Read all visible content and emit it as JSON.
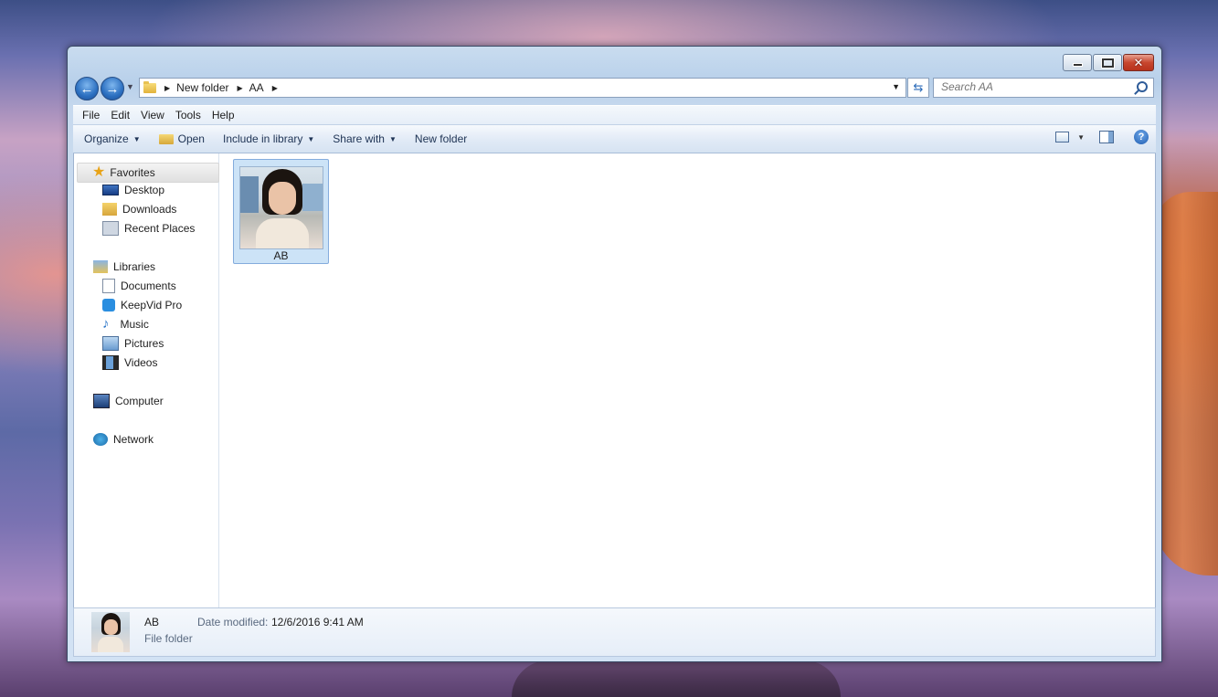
{
  "window": {
    "address": {
      "crumbs": [
        "New folder",
        "AA"
      ]
    },
    "search": {
      "placeholder": "Search AA"
    },
    "menu": [
      "File",
      "Edit",
      "View",
      "Tools",
      "Help"
    ],
    "toolbar": {
      "organize": "Organize",
      "open": "Open",
      "include": "Include in library",
      "share": "Share with",
      "new_folder": "New folder"
    },
    "nav": {
      "favorites": "Favorites",
      "desktop": "Desktop",
      "downloads": "Downloads",
      "recent": "Recent Places",
      "libraries": "Libraries",
      "documents": "Documents",
      "keepvid": "KeepVid Pro",
      "music": "Music",
      "pictures": "Pictures",
      "videos": "Videos",
      "computer": "Computer",
      "network": "Network"
    },
    "items": [
      {
        "name": "AB"
      }
    ],
    "details": {
      "name": "AB",
      "type": "File folder",
      "date_label": "Date modified:",
      "date_value": "12/6/2016 9:41 AM"
    }
  }
}
